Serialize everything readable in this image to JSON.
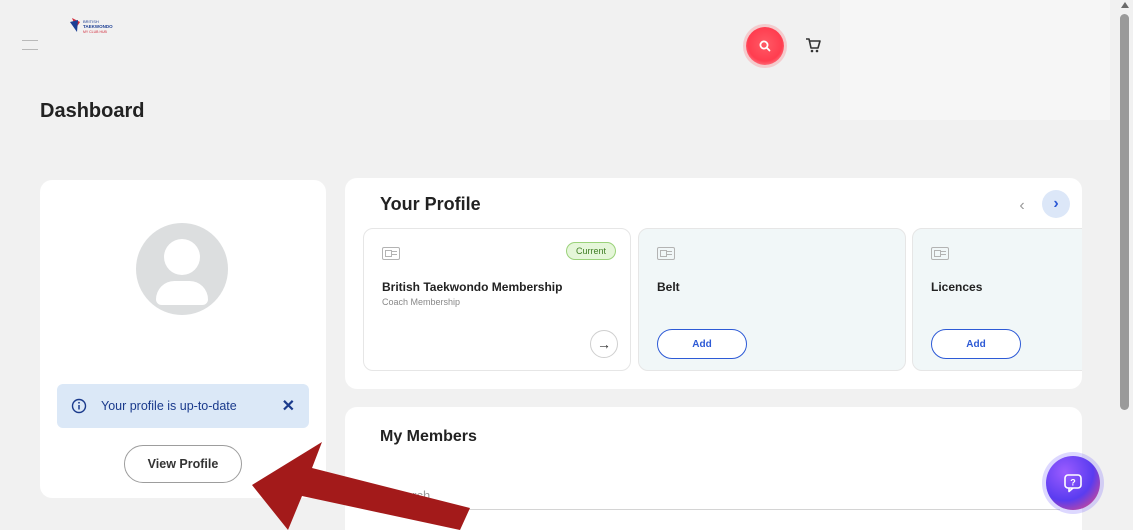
{
  "header": {
    "logo_lines": [
      "BRITISH",
      "TAEKWONDO",
      "MY CLUB HUB"
    ],
    "search_icon": "search-icon",
    "cart_icon": "cart-icon",
    "menu_icon": "hamburger-icon"
  },
  "page": {
    "title": "Dashboard"
  },
  "profile_card": {
    "status_message": "Your profile is up-to-date",
    "view_profile_label": "View Profile"
  },
  "your_profile": {
    "title": "Your Profile",
    "tiles": [
      {
        "title": "British Taekwondo Membership",
        "subtitle": "Coach Membership",
        "badge": "Current",
        "action": "arrow"
      },
      {
        "title": "Belt",
        "action_label": "Add"
      },
      {
        "title": "Licences",
        "action_label": "Add"
      }
    ]
  },
  "my_members": {
    "title": "My Members",
    "search_placeholder": "Search"
  },
  "colors": {
    "accent": "#2d5ad6",
    "search_button": "#ff3d4f",
    "success_badge_bg": "#e5f6d9",
    "info_banner_bg": "#dbe8f7",
    "annotation_arrow": "#a31a1a"
  }
}
